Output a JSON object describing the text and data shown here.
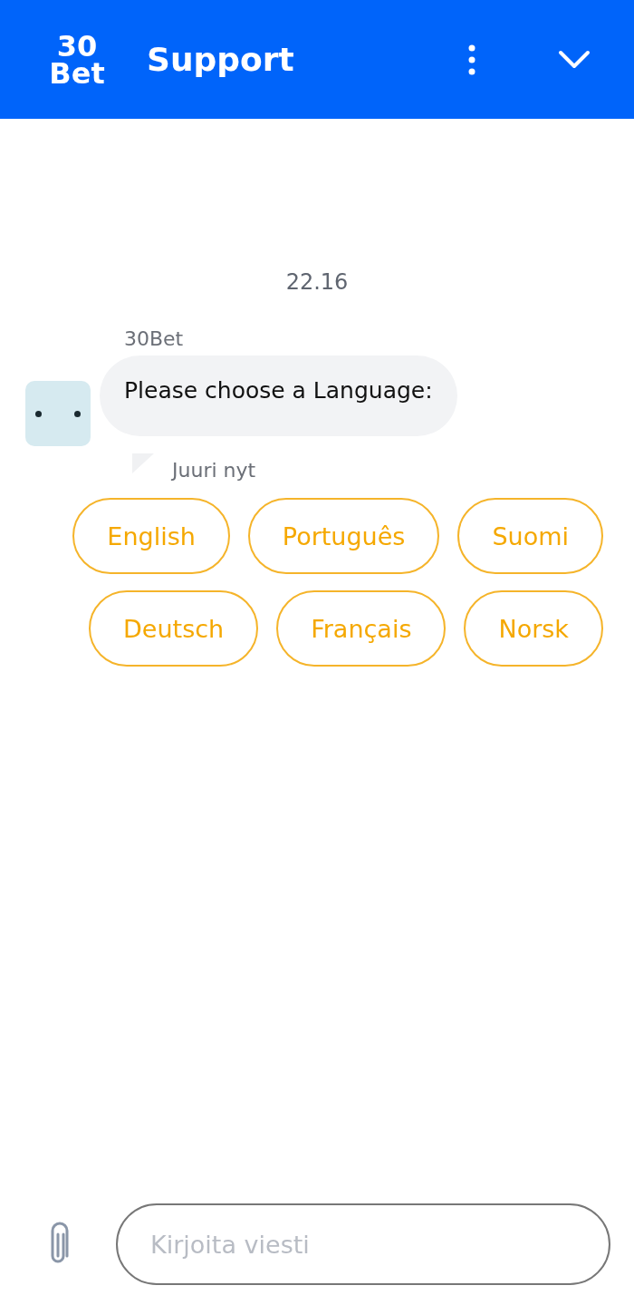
{
  "header": {
    "logo": [
      "30",
      "Bet"
    ],
    "title": "Support"
  },
  "chat": {
    "time": "22.16",
    "sender": "30Bet",
    "message": "Please choose a Language:",
    "timestamp": "Juuri nyt",
    "options": [
      "English",
      "Português",
      "Suomi",
      "Deutsch",
      "Français",
      "Norsk"
    ]
  },
  "composer": {
    "placeholder": "Kirjoita viesti"
  }
}
